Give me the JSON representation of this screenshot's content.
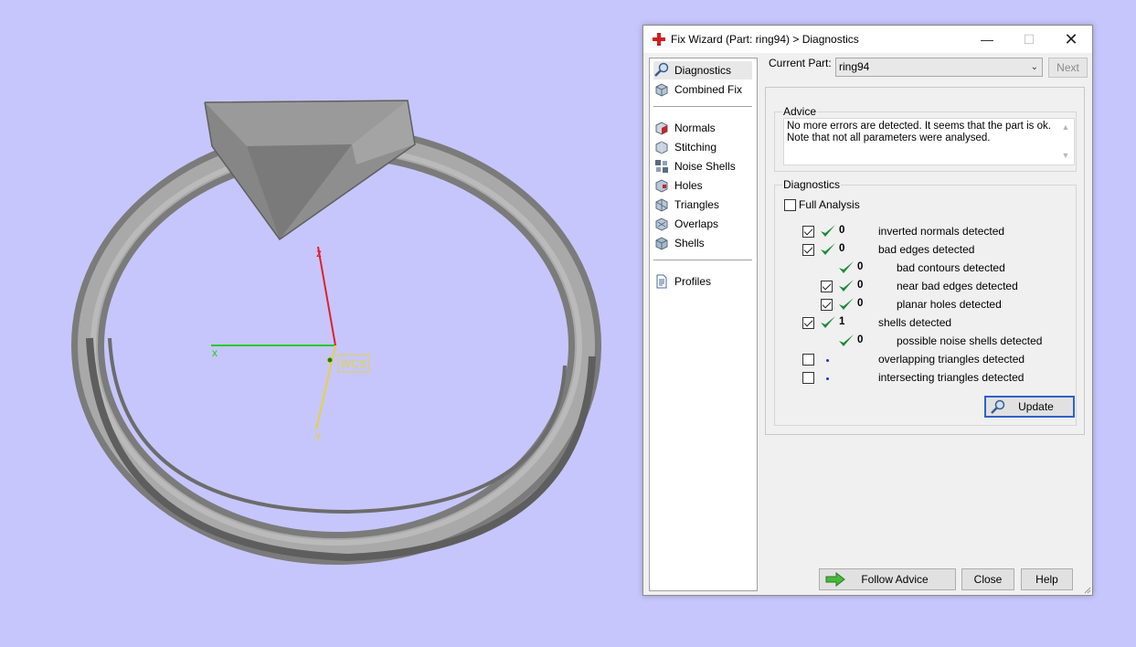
{
  "viewport": {
    "background": "#c6c6fc",
    "axes": {
      "x_label": "x",
      "y_label": "y",
      "z_label": "z",
      "wcs_label": "WCS"
    }
  },
  "window": {
    "title": "Fix Wizard (Part: ring94) > Diagnostics",
    "title_icon": "red-cross-icon",
    "controls": {
      "minimize": "—",
      "maximize": "☐",
      "close": "✕"
    }
  },
  "sidebar": {
    "items": [
      {
        "label": "Diagnostics",
        "icon": "magnifier-icon",
        "selected": true
      },
      {
        "label": "Combined Fix",
        "icon": "cube-icon"
      },
      {
        "label": "Normals",
        "icon": "normals-cube-icon"
      },
      {
        "label": "Stitching",
        "icon": "stitching-cube-icon"
      },
      {
        "label": "Noise Shells",
        "icon": "noise-shells-icon"
      },
      {
        "label": "Holes",
        "icon": "holes-cube-icon"
      },
      {
        "label": "Triangles",
        "icon": "triangles-cube-icon"
      },
      {
        "label": "Overlaps",
        "icon": "overlaps-cube-icon"
      },
      {
        "label": "Shells",
        "icon": "shells-cube-icon"
      },
      {
        "label": "Profiles",
        "icon": "document-icon"
      }
    ]
  },
  "current_part": {
    "label": "Current Part:",
    "value": "ring94",
    "next_label": "Next"
  },
  "advice": {
    "label": "Advice",
    "line1": "No more errors are detected. It seems that the part is ok.",
    "line2": "Note that not all parameters were analysed."
  },
  "diagnostics": {
    "label": "Diagnostics",
    "full_analysis": {
      "label": "Full Analysis",
      "checked": false
    },
    "rows": [
      {
        "checkbox": true,
        "checked": true,
        "status": "ok",
        "count": "0",
        "label": "inverted normals detected",
        "indent": 0
      },
      {
        "checkbox": true,
        "checked": true,
        "status": "ok",
        "count": "0",
        "label": "bad edges detected",
        "indent": 0
      },
      {
        "checkbox": false,
        "checked": false,
        "status": "ok",
        "count": "0",
        "label": "bad contours detected",
        "indent": 1
      },
      {
        "checkbox": true,
        "checked": true,
        "status": "ok",
        "count": "0",
        "label": "near bad edges detected",
        "indent": 1
      },
      {
        "checkbox": true,
        "checked": true,
        "status": "ok",
        "count": "0",
        "label": "planar holes detected",
        "indent": 1
      },
      {
        "checkbox": true,
        "checked": true,
        "status": "ok",
        "count": "1",
        "label": "shells detected",
        "indent": 0
      },
      {
        "checkbox": false,
        "checked": false,
        "status": "ok",
        "count": "0",
        "label": "possible noise shells detected",
        "indent": 1
      },
      {
        "checkbox": true,
        "checked": false,
        "status": "pending",
        "count": "",
        "label": "overlapping triangles detected",
        "indent": 0
      },
      {
        "checkbox": true,
        "checked": false,
        "status": "pending",
        "count": "",
        "label": "intersecting triangles detected",
        "indent": 0
      }
    ],
    "update_label": "Update"
  },
  "buttons": {
    "follow_advice": "Follow Advice",
    "close": "Close",
    "help": "Help"
  },
  "colors": {
    "ok_check": "#1d8a3a",
    "accent_border": "#2e62c9",
    "pending_dot": "#1b2fd6"
  }
}
